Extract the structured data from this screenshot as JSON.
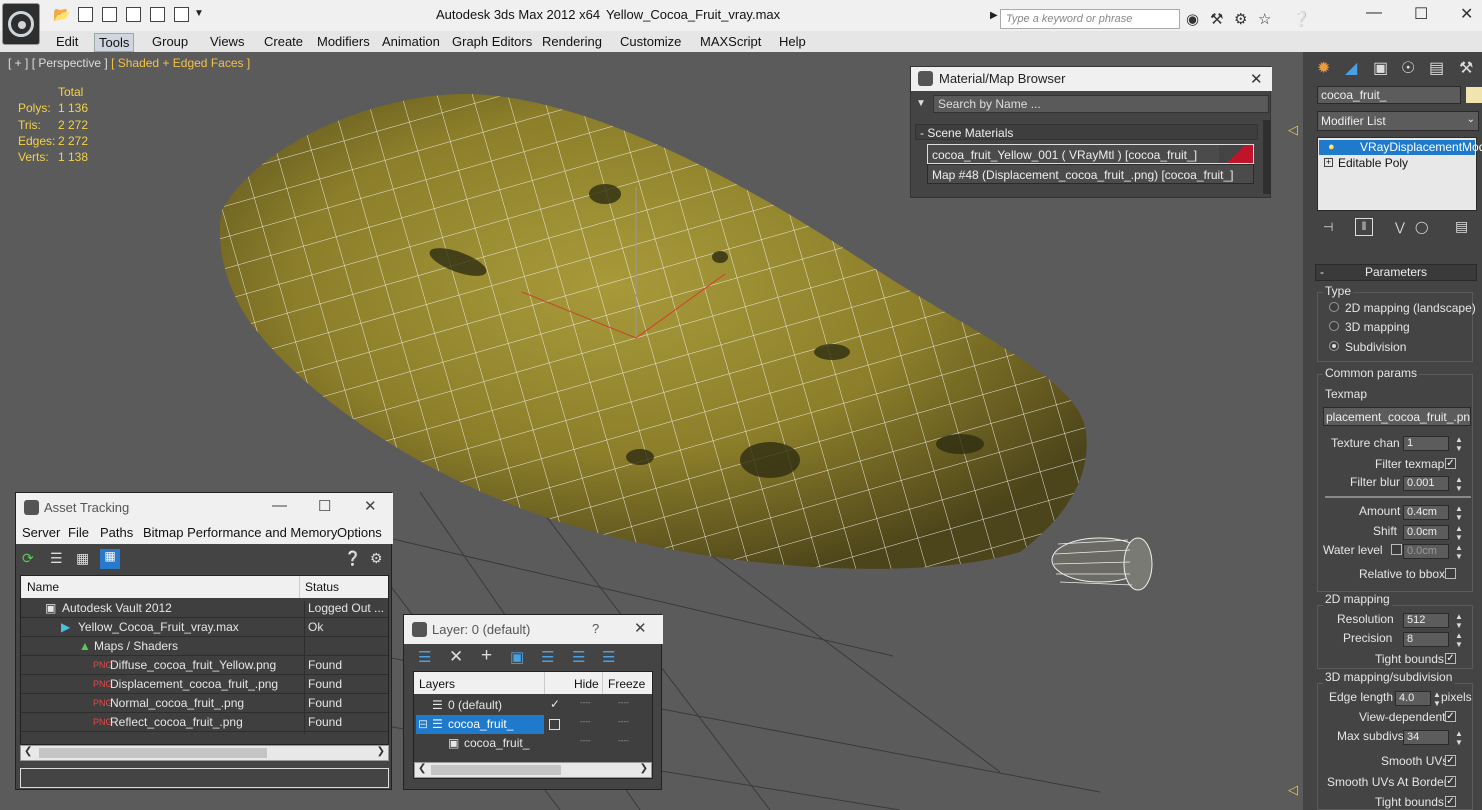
{
  "window": {
    "app_title": "Autodesk 3ds Max  2012 x64",
    "file_title": "Yellow_Cocoa_Fruit_vray.max",
    "search_placeholder": "Type a keyword or phrase"
  },
  "menubar": [
    "Edit",
    "Tools",
    "Group",
    "Views",
    "Create",
    "Modifiers",
    "Animation",
    "Graph Editors",
    "Rendering",
    "Customize",
    "MAXScript",
    "Help"
  ],
  "viewport": {
    "label_plus": "[ + ]",
    "label_view": "[ Perspective ]",
    "label_shading": "[ Shaded + Edged Faces ]",
    "stats_header": "Total",
    "stats": [
      {
        "label": "Polys:",
        "value": "1 136"
      },
      {
        "label": "Tris:",
        "value": "2 272"
      },
      {
        "label": "Edges:",
        "value": "2 272"
      },
      {
        "label": "Verts:",
        "value": "1 138"
      }
    ]
  },
  "material_browser": {
    "title": "Material/Map Browser",
    "search_placeholder": "Search by Name ...",
    "section": "Scene Materials",
    "items": [
      "cocoa_fruit_Yellow_001  ( VRayMtl )  [cocoa_fruit_]",
      "Map #48 (Displacement_cocoa_fruit_.png) [cocoa_fruit_]"
    ]
  },
  "command_panel": {
    "object_name": "cocoa_fruit_",
    "modifier_list": "Modifier List",
    "stack": [
      "VRayDisplacementMod",
      "Editable Poly"
    ],
    "rollout": "Parameters",
    "type_group": "Type",
    "type_options": [
      "2D mapping (landscape)",
      "3D mapping",
      "Subdivision"
    ],
    "common_group": "Common params",
    "texmap_label": "Texmap",
    "texmap_value": "placement_cocoa_fruit_.png)",
    "texture_chan_label": "Texture chan",
    "texture_chan_value": "1",
    "filter_texmap_label": "Filter texmap",
    "filter_blur_label": "Filter blur",
    "filter_blur_value": "0.001",
    "amount_label": "Amount",
    "amount_value": "0.4cm",
    "shift_label": "Shift",
    "shift_value": "0.0cm",
    "water_level_label": "Water level",
    "water_level_value": "0.0cm",
    "relative_bbox_label": "Relative to bbox",
    "mapping2d_group": "2D mapping",
    "resolution_label": "Resolution",
    "resolution_value": "512",
    "precision_label": "Precision",
    "precision_value": "8",
    "tight_bounds_label": "Tight bounds",
    "mapping3d_group": "3D mapping/subdivision",
    "edge_length_label": "Edge length",
    "edge_length_value": "4.0",
    "pixels_label": "pixels",
    "view_dependent_label": "View-dependent",
    "max_subdivs_label": "Max subdivs",
    "max_subdivs_value": "34",
    "smooth_uvs_label": "Smooth UVs",
    "smooth_uvs_borders_label": "Smooth UVs At Borders",
    "tight_bounds2_label": "Tight bounds"
  },
  "asset_tracking": {
    "title": "Asset Tracking",
    "menu": [
      "Server",
      "File",
      "Paths",
      "Bitmap Performance and Memory",
      "Options"
    ],
    "col_name": "Name",
    "col_status": "Status",
    "rows": [
      {
        "name": "Autodesk Vault 2012",
        "status": "Logged Out ..."
      },
      {
        "name": "Yellow_Cocoa_Fruit_vray.max",
        "status": "Ok"
      },
      {
        "name": "Maps / Shaders",
        "status": ""
      },
      {
        "name": "Diffuse_cocoa_fruit_Yellow.png",
        "status": "Found"
      },
      {
        "name": "Displacement_cocoa_fruit_.png",
        "status": "Found"
      },
      {
        "name": "Normal_cocoa_fruit_.png",
        "status": "Found"
      },
      {
        "name": "Reflect_cocoa_fruit_.png",
        "status": "Found"
      }
    ]
  },
  "layer_dialog": {
    "title": "Layer: 0 (default)",
    "help": "?",
    "col_layers": "Layers",
    "col_hide": "Hide",
    "col_freeze": "Freeze",
    "rows": [
      "0 (default)",
      "cocoa_fruit_",
      "cocoa_fruit_"
    ]
  }
}
